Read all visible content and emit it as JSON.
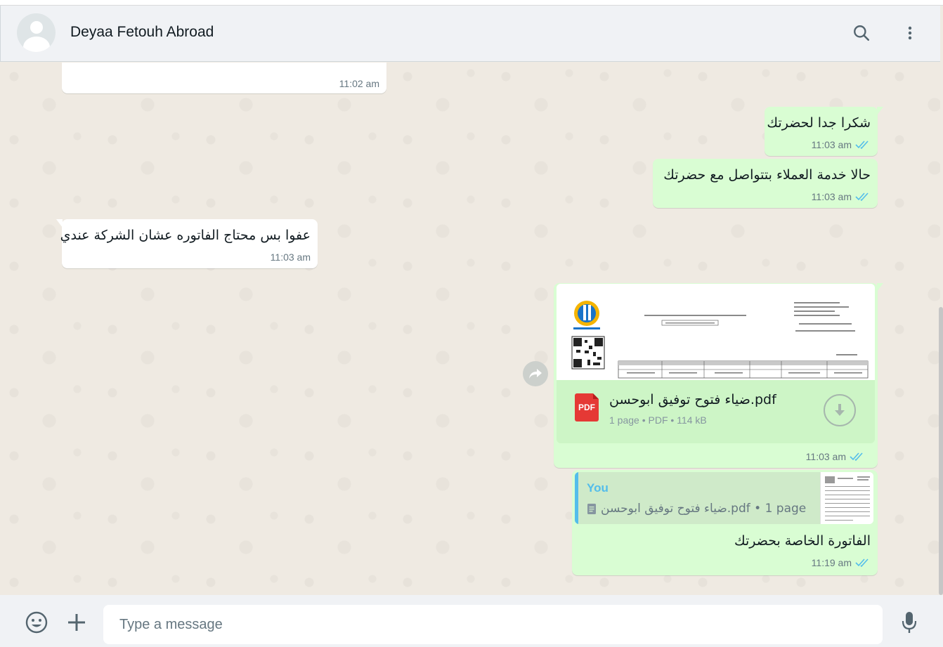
{
  "header": {
    "contact_name": "Deyaa Fetouh Abroad",
    "icons": [
      "default-avatar-icon",
      "search-icon",
      "menu-dots-icon"
    ]
  },
  "messages": [
    {
      "id": "m1",
      "direction": "incoming",
      "text": "",
      "time": "11:02 am"
    },
    {
      "id": "m2",
      "direction": "outgoing",
      "text": "شكرا جدا لحضرتك",
      "time": "11:03 am",
      "status": "read"
    },
    {
      "id": "m3",
      "direction": "outgoing",
      "text": "حالا خدمة العملاء بتتواصل مع حضرتك",
      "time": "11:03 am",
      "status": "read"
    },
    {
      "id": "m4",
      "direction": "incoming",
      "text": "عفوا بس محتاج الفاتوره عشان الشركة عندي",
      "time": "11:03 am"
    },
    {
      "id": "m5",
      "direction": "outgoing",
      "type": "document",
      "doc_name": "ضياء فتوح توفيق ابوحسن.pdf",
      "doc_info": "1 page • PDF • 114 kB",
      "icon_label": "PDF",
      "time": "11:03 am",
      "status": "read"
    },
    {
      "id": "m6",
      "direction": "outgoing",
      "type": "reply",
      "quote_author": "You",
      "quote_text": "ضياء فتوح توفيق ابوحسن.pdf • 1 page",
      "text": "الفاتورة الخاصة بحضرتك",
      "time": "11:19 am",
      "status": "read"
    }
  ],
  "composer": {
    "placeholder": "Type a message",
    "icons": [
      "emoji-icon",
      "plus-icon",
      "mic-icon"
    ]
  },
  "colors": {
    "outgoing_bubble": "#d9fdd3",
    "incoming_bubble": "#ffffff",
    "chat_background": "#efeae2",
    "read_ticks": "#53bdeb",
    "pdf_red": "#e53935"
  }
}
